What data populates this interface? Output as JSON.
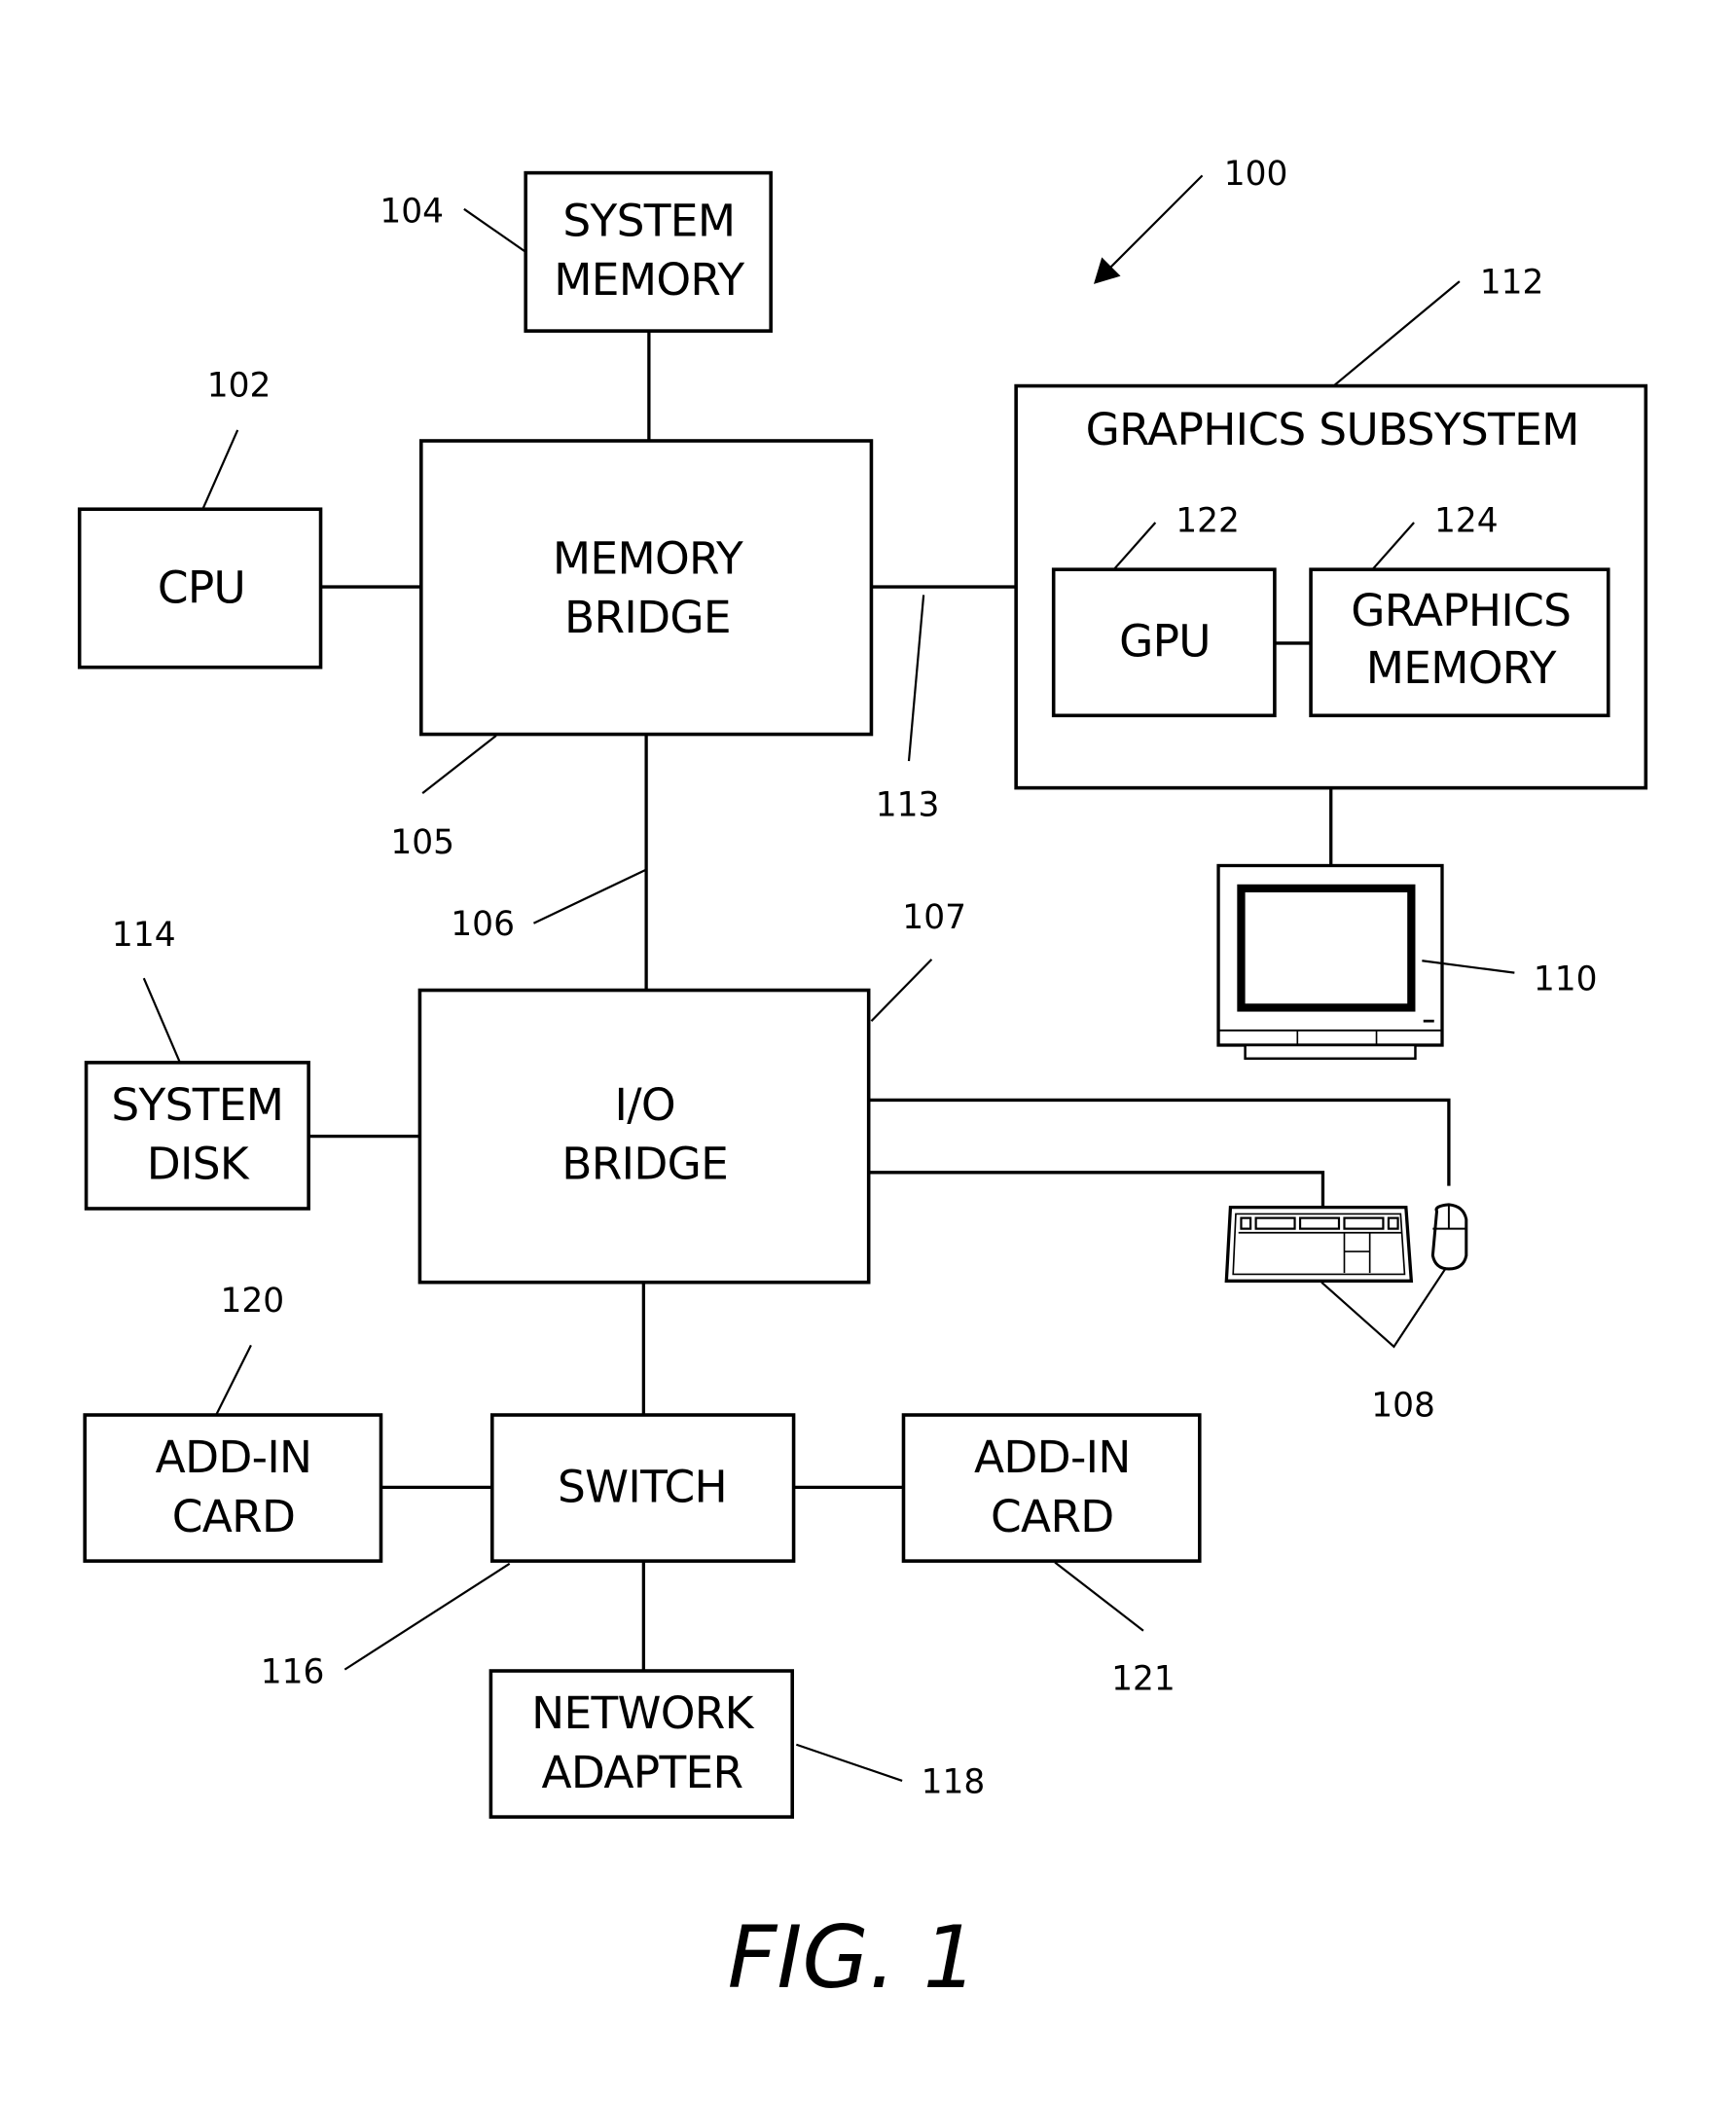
{
  "figure": {
    "caption": "FIG. 1",
    "system_ref": "100"
  },
  "blocks": {
    "system_memory": {
      "lines": [
        "SYSTEM",
        "MEMORY"
      ],
      "ref": "104"
    },
    "cpu": {
      "lines": [
        "CPU"
      ],
      "ref": "102"
    },
    "memory_bridge": {
      "lines": [
        "MEMORY",
        "BRIDGE"
      ],
      "ref": "105"
    },
    "graphics_subsystem": {
      "lines": [
        "GRAPHICS SUBSYSTEM"
      ],
      "ref": "112"
    },
    "gpu": {
      "lines": [
        "GPU"
      ],
      "ref": "122"
    },
    "graphics_memory": {
      "lines": [
        "GRAPHICS",
        "MEMORY"
      ],
      "ref": "124"
    },
    "system_disk": {
      "lines": [
        "SYSTEM",
        "DISK"
      ],
      "ref": "114"
    },
    "io_bridge": {
      "lines": [
        "I/O",
        "BRIDGE"
      ],
      "ref": "107"
    },
    "add_in_card_left": {
      "lines": [
        "ADD-IN",
        "CARD"
      ],
      "ref": "120"
    },
    "switch": {
      "lines": [
        "SWITCH"
      ],
      "ref": "116"
    },
    "add_in_card_right": {
      "lines": [
        "ADD-IN",
        "CARD"
      ],
      "ref": "121"
    },
    "network_adapter": {
      "lines": [
        "NETWORK",
        "ADAPTER"
      ],
      "ref": "118"
    }
  },
  "connections": {
    "bus_106_ref": "106",
    "bus_113_ref": "113"
  },
  "peripherals": {
    "display_ref": "110",
    "input_devices_ref": "108"
  }
}
